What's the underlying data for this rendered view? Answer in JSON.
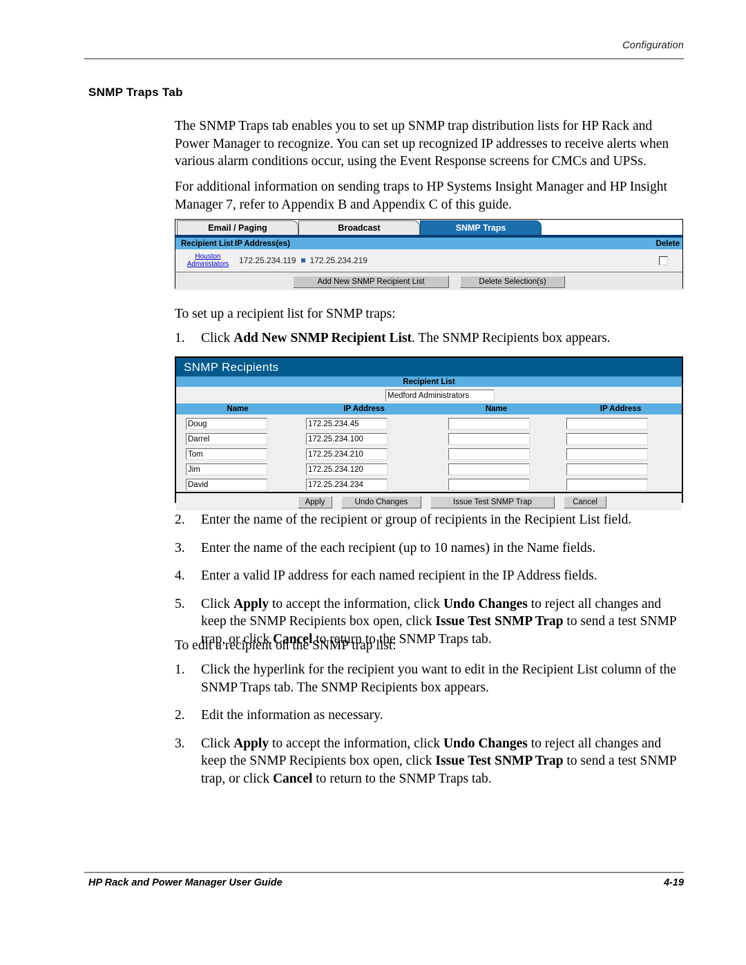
{
  "page": {
    "running_head": "Configuration",
    "heading": "SNMP Traps Tab",
    "footer_left": "HP Rack and Power Manager User Guide",
    "footer_right": "4-19"
  },
  "colors": {
    "dialog_title_blue": "#005a8c",
    "subheader_blue": "#5aaee0",
    "active_tab_blue": "#1a6fad",
    "tab_underline_blue": "#003c73",
    "link_blue": "#0000cc",
    "button_face": "#c8c8c8"
  },
  "intro": {
    "paragraph_1": "The SNMP Traps tab enables you to set up SNMP trap distribution lists for HP Rack and Power Manager to recognize. You can set up recognized IP addresses to receive alerts when various alarm conditions occur, using the Event Response screens for CMCs and UPSs.",
    "paragraph_2": "For additional information on sending traps to HP Systems Insight Manager and HP Insight Manager 7, refer to Appendix B and Appendix C of this guide."
  },
  "snmp_traps_screen": {
    "tabs": [
      {
        "label": "Email / Paging",
        "active": false
      },
      {
        "label": "Broadcast",
        "active": false
      },
      {
        "label": "SNMP Traps",
        "active": true
      }
    ],
    "columns": {
      "recipient_list": "Recipient List",
      "ip_addresses": "IP Address(es)",
      "delete": "Delete"
    },
    "rows": [
      {
        "recipient_list": "Houston Administators",
        "recipient_line_1": "Houston",
        "recipient_line_2": "Administators",
        "ip_1": "172.25.234.119",
        "ip_2": "172.25.234.219",
        "delete_checked": false
      }
    ],
    "buttons": {
      "add_new": "Add New SNMP Recipient List",
      "delete_selections": "Delete Selection(s)"
    }
  },
  "snmp_recipients_dialog": {
    "title": "SNMP Recipients",
    "recipient_list_label": "Recipient List",
    "recipient_list_value": "Medford Administrators",
    "column_headers": {
      "name_left": "Name",
      "ip_left": "IP Address",
      "name_right": "Name",
      "ip_right": "IP Address"
    },
    "rows": [
      {
        "name_left": "Doug",
        "ip_left": "172.25.234.45",
        "name_right": "",
        "ip_right": ""
      },
      {
        "name_left": "Darrel",
        "ip_left": "172.25.234.100",
        "name_right": "",
        "ip_right": ""
      },
      {
        "name_left": "Tom",
        "ip_left": "172.25.234.210",
        "name_right": "",
        "ip_right": ""
      },
      {
        "name_left": "Jim",
        "ip_left": "172.25.234.120",
        "name_right": "",
        "ip_right": ""
      },
      {
        "name_left": "David",
        "ip_left": "172.25.234.234",
        "name_right": "",
        "ip_right": ""
      }
    ],
    "buttons": {
      "apply": "Apply",
      "undo": "Undo Changes",
      "issue_test": "Issue Test SNMP Trap",
      "cancel": "Cancel"
    }
  },
  "procedure_setup": {
    "lead_in": "To set up a recipient list for SNMP traps:",
    "steps": [
      {
        "num": "1.",
        "html": "Click <b>Add New SNMP Recipient List</b>. The SNMP Recipients box appears."
      },
      {
        "num": "2.",
        "html": "Enter the name of the recipient or group of recipients in the Recipient List field."
      },
      {
        "num": "3.",
        "html": "Enter the name of the each recipient (up to 10 names) in the Name fields."
      },
      {
        "num": "4.",
        "html": "Enter a valid IP address for each named recipient in the IP Address fields."
      },
      {
        "num": "5.",
        "html": "Click <b>Apply</b> to accept the information, click <b>Undo Changes</b> to reject all changes and keep the SNMP Recipients box open, click <b>Issue Test SNMP Trap</b> to send a test SNMP trap, or click <b>Cancel</b> to return to the SNMP Traps tab."
      }
    ]
  },
  "procedure_edit": {
    "lead_in": "To edit a recipient on the SNMP trap list:",
    "steps": [
      {
        "num": "1.",
        "html": "Click the hyperlink for the recipient you want to edit in the Recipient List column of the SNMP Traps tab. The SNMP Recipients box appears."
      },
      {
        "num": "2.",
        "html": "Edit the information as necessary."
      },
      {
        "num": "3.",
        "html": "Click <b>Apply</b> to accept the information, click <b>Undo Changes</b> to reject all changes and keep the SNMP Recipients box open, click <b>Issue Test SNMP Trap</b> to send a test SNMP trap, or click <b>Cancel</b> to return to the SNMP Traps tab."
      }
    ]
  }
}
